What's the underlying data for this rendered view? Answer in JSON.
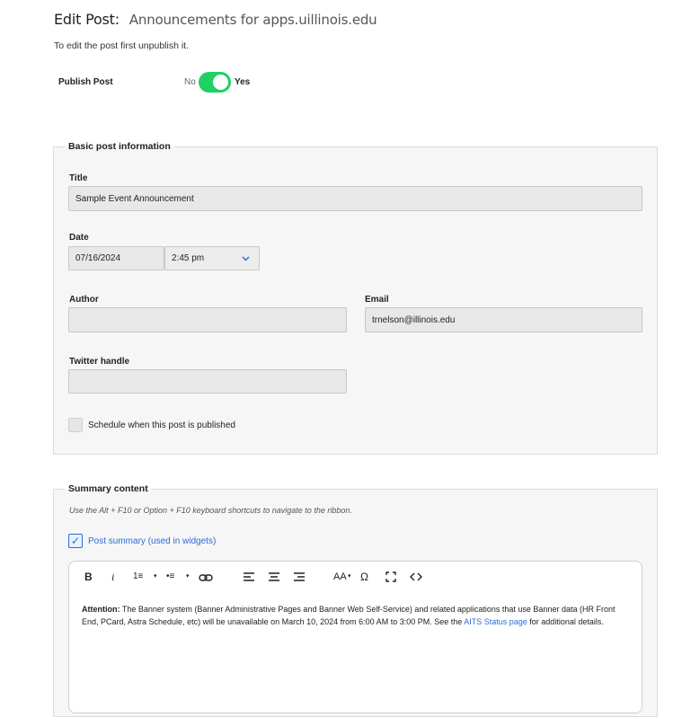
{
  "header": {
    "title": "Edit Post:",
    "subtitle": "Announcements for apps.uillinois.edu",
    "helper": "To edit the post first unpublish it."
  },
  "publish": {
    "label": "Publish Post",
    "no_label": "No",
    "yes_label": "Yes",
    "enabled": true
  },
  "basic_info": {
    "legend": "Basic post information",
    "title_label": "Title",
    "title_value": "Sample Event Announcement",
    "date_label": "Date",
    "date_value": "07/16/2024",
    "time_value": "2:45 pm",
    "author_label": "Author",
    "author_value": "",
    "email_label": "Email",
    "email_value": "trnelson@illinois.edu",
    "twitter_label": "Twitter handle",
    "twitter_value": "",
    "schedule_label": "Schedule when this post is published"
  },
  "summary": {
    "legend": "Summary content",
    "hint": "Use the Alt + F10 or Option + F10 keyboard shortcuts to navigate to the ribbon.",
    "checkbox_label": "Post summary  (used in widgets)",
    "checked": true,
    "toolbar": {
      "bold": "B",
      "italic": "i",
      "ordered_list": "1≡",
      "bullet_list": "•≡",
      "link": "⊸",
      "align_left": "≡",
      "align_center": "≡",
      "align_right": "≡",
      "font_size": "AA",
      "special_char": "Ω",
      "fullscreen": "⛶",
      "source": "<>",
      "caret": "▾"
    },
    "body": {
      "strong": "Attention:",
      "text_before": " The Banner system (Banner Administrative Pages and Banner Web Self-Service) and related applications that use Banner data (HR Front End, PCard, Astra Schedule, etc) will be unavailable on March 10, 2024 from 6:00 AM to 3:00 PM. See the ",
      "link_text": "AITS Status page",
      "text_after": " for additional details."
    }
  },
  "colors": {
    "toggle_on": "#20d063",
    "link": "#2b6cd9",
    "panel_bg": "#f6f6f6",
    "input_bg": "#e8e8e8"
  }
}
